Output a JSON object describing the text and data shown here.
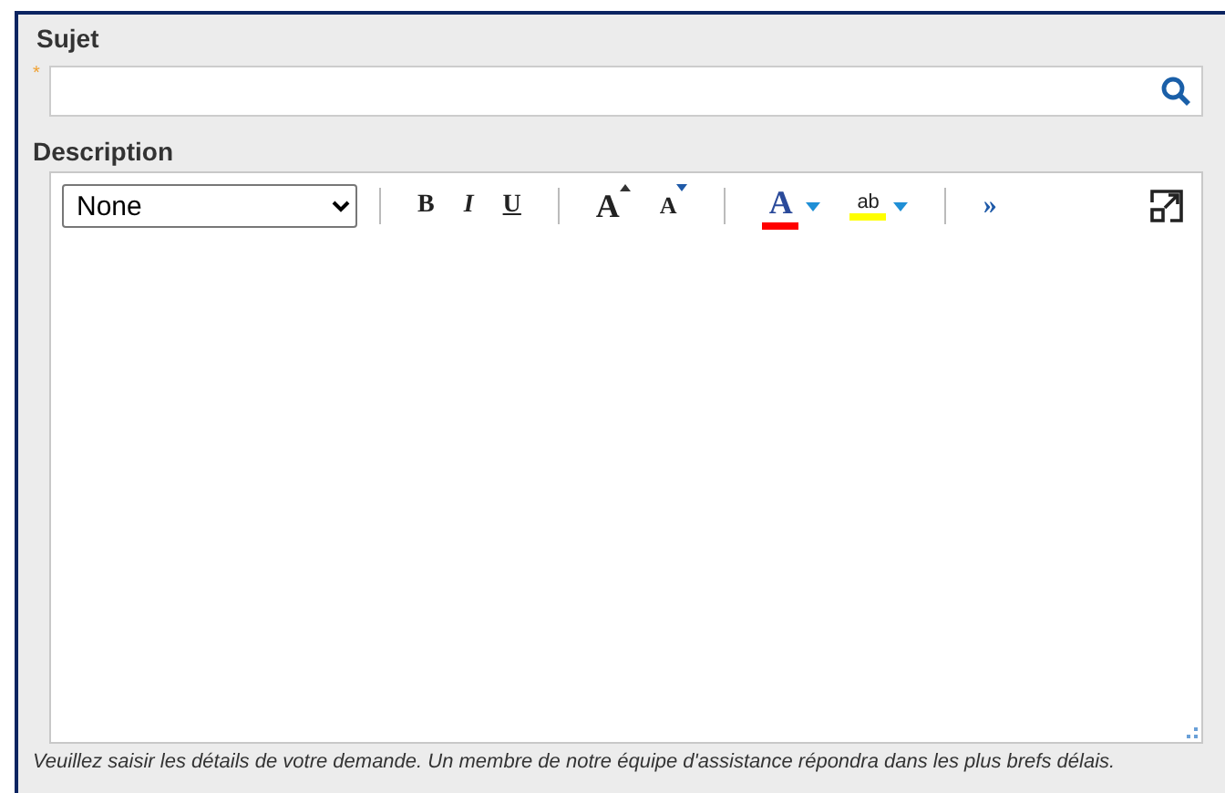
{
  "subject": {
    "label": "Sujet",
    "required_mark": "*"
  },
  "description": {
    "label": "Description",
    "hint": "Veuillez saisir les détails de votre demande. Un membre de notre équipe d'assistance répondra dans les plus brefs délais."
  },
  "toolbar": [
    {
      "kind": "select",
      "value": "None"
    },
    {
      "kind": "separator"
    },
    {
      "kind": "bold",
      "label": "B"
    },
    {
      "kind": "italic",
      "label": "I"
    },
    {
      "kind": "underline",
      "label": "U"
    },
    {
      "kind": "separator"
    },
    {
      "kind": "grow",
      "label": "A"
    },
    {
      "kind": "shrink",
      "label": "A"
    },
    {
      "kind": "separator"
    },
    {
      "kind": "color",
      "label": "A",
      "color": "#ff0000"
    },
    {
      "kind": "highlight",
      "label": "ab",
      "color": "#ffff00"
    },
    {
      "kind": "separator"
    },
    {
      "kind": "more",
      "label": "»"
    },
    {
      "kind": "expand"
    }
  ]
}
